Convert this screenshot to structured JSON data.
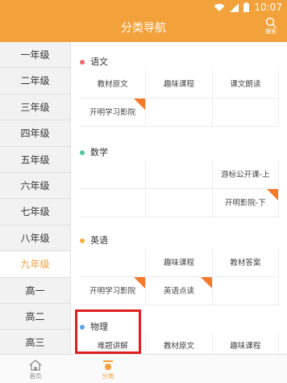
{
  "status_bar": {
    "time": "10:07"
  },
  "header": {
    "title": "分类导航",
    "search_label": "搜索"
  },
  "sidebar": {
    "items": [
      {
        "label": "一年级"
      },
      {
        "label": "二年级"
      },
      {
        "label": "三年级"
      },
      {
        "label": "四年级"
      },
      {
        "label": "五年级"
      },
      {
        "label": "六年级"
      },
      {
        "label": "七年级"
      },
      {
        "label": "八年级"
      },
      {
        "label": "九年级",
        "selected": true
      },
      {
        "label": "高一"
      },
      {
        "label": "高二"
      },
      {
        "label": "高三"
      }
    ]
  },
  "sections": [
    {
      "title": "语文",
      "dot_color": "#ee6b6b",
      "rows": [
        [
          {
            "label": "教材原文"
          },
          {
            "label": "趣味课程"
          },
          {
            "label": "课文朗读"
          }
        ],
        [
          {
            "label": "开明学习影院",
            "badge": true
          },
          {
            "label": ""
          },
          {
            "label": ""
          }
        ]
      ]
    },
    {
      "title": "数学",
      "dot_color": "#4fc79a",
      "rows": [
        [
          {
            "label": ""
          },
          {
            "label": ""
          },
          {
            "label": "游标公开课-上"
          }
        ],
        [
          {
            "label": ""
          },
          {
            "label": ""
          },
          {
            "label": "开明影院-下",
            "badge": true
          }
        ]
      ]
    },
    {
      "title": "英语",
      "dot_color": "#f3b23a",
      "rows": [
        [
          {
            "label": ""
          },
          {
            "label": "趣味课程"
          },
          {
            "label": "教材答案"
          }
        ],
        [
          {
            "label": "开明学习影院",
            "badge": true
          },
          {
            "label": "英语点读",
            "badge": true
          },
          {
            "label": ""
          }
        ]
      ]
    },
    {
      "title": "物理",
      "dot_color": "#5aa6e8",
      "rows": [
        [
          {
            "label": "难题讲解"
          },
          {
            "label": "教材原文"
          },
          {
            "label": "趣味课程"
          }
        ]
      ]
    }
  ],
  "tab_bar": {
    "tabs": [
      {
        "label": "首页",
        "icon": "home-icon"
      },
      {
        "label": "分类",
        "icon": "category-icon",
        "selected": true
      }
    ]
  },
  "colors": {
    "accent": "#f3a13a",
    "highlight": "#e02020",
    "badge": "#f47a2a"
  }
}
